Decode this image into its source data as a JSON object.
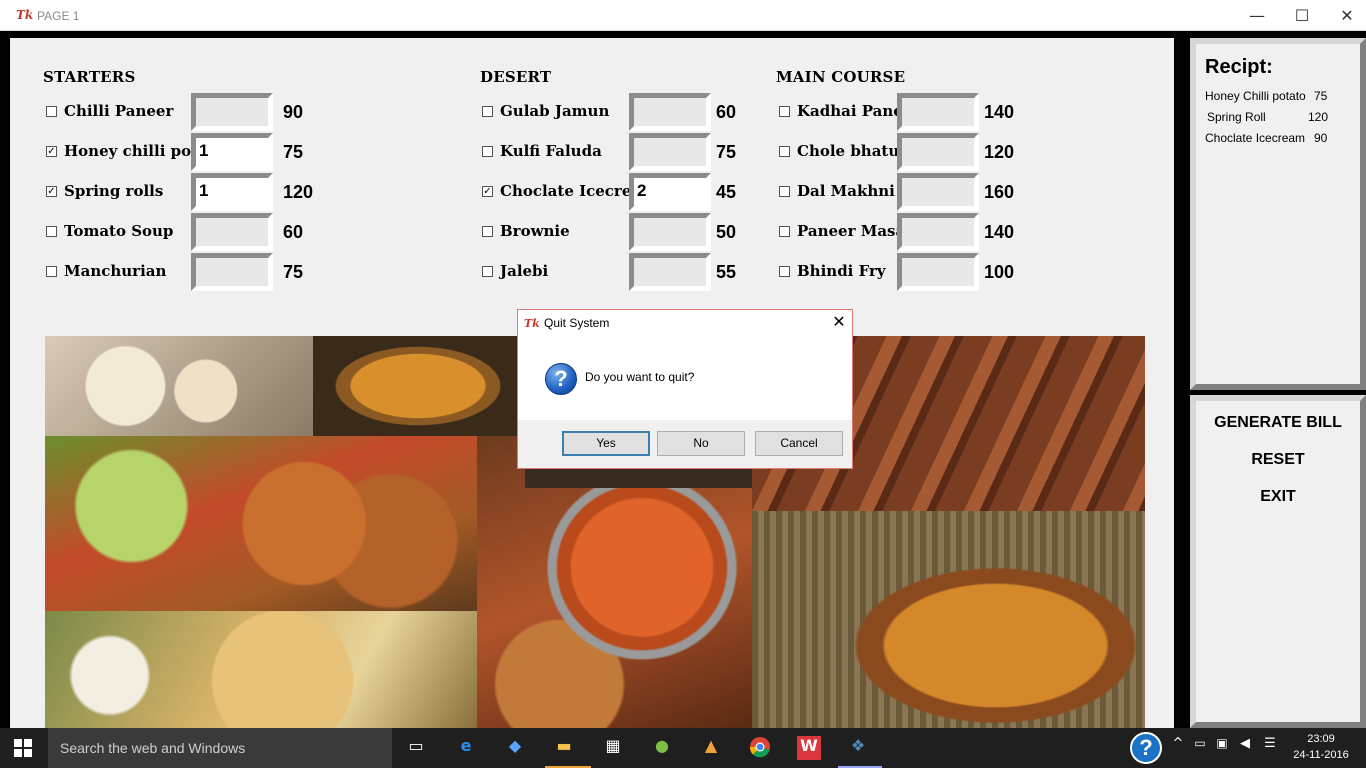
{
  "window": {
    "title": "PAGE 1",
    "tk_glyph": "Tk"
  },
  "starters": {
    "heading": "STARTERS",
    "items": [
      {
        "label": "Chilli Paneer",
        "checked": false,
        "qty": "",
        "price": "90"
      },
      {
        "label": "Honey chilli potato",
        "checked": true,
        "qty": "1",
        "price": "75"
      },
      {
        "label": "Spring rolls",
        "checked": true,
        "qty": "1",
        "price": "120"
      },
      {
        "label": "Tomato Soup",
        "checked": false,
        "qty": "",
        "price": "60"
      },
      {
        "label": "Manchurian",
        "checked": false,
        "qty": "",
        "price": "75"
      }
    ]
  },
  "desert": {
    "heading": "DESERT",
    "items": [
      {
        "label": "Gulab Jamun",
        "checked": false,
        "qty": "",
        "price": "60"
      },
      {
        "label": "Kulfi Faluda",
        "checked": false,
        "qty": "",
        "price": "75"
      },
      {
        "label": "Choclate Icecream",
        "checked": true,
        "qty": "2",
        "price": "45"
      },
      {
        "label": "Brownie",
        "checked": false,
        "qty": "",
        "price": "50"
      },
      {
        "label": "Jalebi",
        "checked": false,
        "qty": "",
        "price": "55"
      }
    ]
  },
  "main_course": {
    "heading": "MAIN COURSE",
    "items": [
      {
        "label": "Kadhai Paneer",
        "checked": false,
        "qty": "",
        "price": "140"
      },
      {
        "label": "Chole bhature",
        "checked": false,
        "qty": "",
        "price": "120"
      },
      {
        "label": "Dal Makhni",
        "checked": false,
        "qty": "",
        "price": "160"
      },
      {
        "label": "Paneer Masala",
        "checked": false,
        "qty": "",
        "price": "140"
      },
      {
        "label": "Bhindi Fry",
        "checked": false,
        "qty": "",
        "price": "100"
      }
    ]
  },
  "receipt": {
    "title": "Recipt:",
    "lines": [
      {
        "name": "Honey Chilli potato",
        "amount": "75"
      },
      {
        "name": "Spring Roll",
        "amount": "120"
      },
      {
        "name": "Choclate Icecream",
        "amount": "90"
      }
    ]
  },
  "actions": {
    "generate": "GENERATE BILL",
    "reset": "RESET",
    "exit": "EXIT"
  },
  "dialog": {
    "title": "Quit System",
    "message": "Do you want to quit?",
    "yes": "Yes",
    "no": "No",
    "cancel": "Cancel",
    "close_glyph": "✕",
    "question_glyph": "?"
  },
  "taskbar": {
    "search_placeholder": "Search the web and Windows",
    "time": "23:09",
    "date": "24-11-2016",
    "help_glyph": "?"
  }
}
